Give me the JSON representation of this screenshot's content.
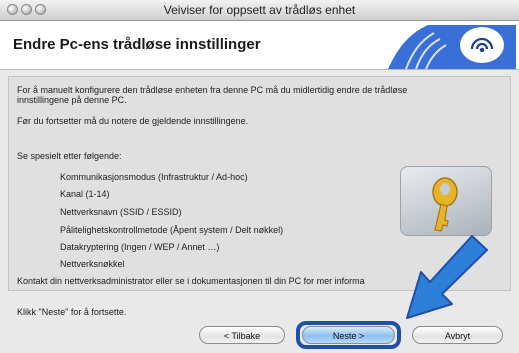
{
  "window": {
    "title": "Veiviser for oppsett av trådløs enhet"
  },
  "header": {
    "title": "Endre Pc-ens trådløse innstillinger"
  },
  "content": {
    "intro": "For å manuelt konfigurere den trådløse enheten fra denne PC må du midlertidig endre de trådløse",
    "intro2": "innstillingene på denne PC.",
    "note": "Før du fortsetter må du notere de gjeldende innstillingene.",
    "look_for": "Se spesielt etter følgende:",
    "items": [
      "Kommunikasjonsmodus (Infrastruktur / Ad-hoc)",
      "Kanal (1-14)",
      "Nettverksnavn (SSID / ESSID)",
      "Pålitelighetskontrollmetode (Åpent system / Delt nøkkel)",
      "Datakryptering (Ingen / WEP / Annet …)",
      "Nettverksnøkkel"
    ],
    "contact": "Kontakt din nettverksadministrator eller se i dokumentasjonen til din PC for mer infor",
    "contact_tail": "ma",
    "next_hint": "Klikk \"Neste\" for å fortsette."
  },
  "buttons": {
    "back": "< Tilbake",
    "next": "Neste >",
    "cancel": "Avbryt"
  },
  "icons": {
    "wireless": "wireless-logo-icon",
    "key": "key-icon",
    "arrow": "pointer-arrow-icon"
  },
  "colors": {
    "accent": "#1f4fa8",
    "logo_blue": "#3a6fd8"
  }
}
